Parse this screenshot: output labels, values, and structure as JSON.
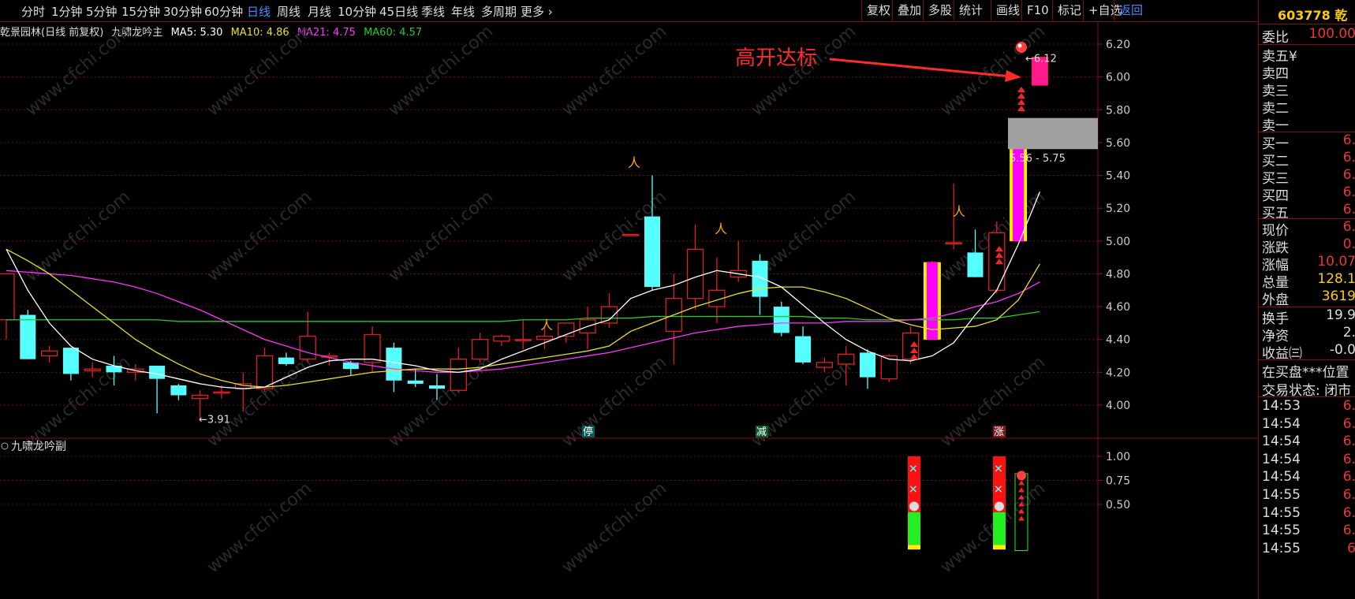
{
  "toolbar": {
    "periods": [
      "分时",
      "1分钟",
      "5分钟",
      "15分钟",
      "30分钟",
      "60分钟",
      "日线",
      "周线",
      "月线",
      "10分钟",
      "45日线",
      "季线",
      "年线",
      "多周期",
      "更多 ›"
    ],
    "active_period": "日线",
    "right_buttons": [
      "复权",
      "叠加",
      "多股",
      "统计",
      "画线",
      "F10",
      "标记",
      "+自选",
      "返回"
    ]
  },
  "legend": {
    "stock_name": "乾景园林(日线 前复权)",
    "indicator": "九啸龙吟主",
    "ma5": "MA5: 5.30",
    "ma10": "MA10: 4.86",
    "ma21": "MA21: 4.75",
    "ma60": "MA60: 4.57"
  },
  "sub_panel": {
    "title": "九啸龙吟副"
  },
  "annotation": {
    "text": "高开达标",
    "price_label": "6.12",
    "low_label": "3.91",
    "range_label": "5.56 - 5.75"
  },
  "markers": {
    "ting": "停",
    "jian": "减",
    "zhang": "涨"
  },
  "watermark": "www.cfchi.com",
  "colors": {
    "up": "#e02020",
    "down": "#55ffff",
    "ma5": "#ffffff",
    "ma10": "#e8e020",
    "ma21": "#ff33ff",
    "ma60": "#22cc22",
    "axis": "#8a1010"
  },
  "right_panel": {
    "code": "603778",
    "name": "乾",
    "weibi_label": "委比",
    "weibi_value": "100.00",
    "sell_labels": [
      "卖五",
      "卖四",
      "卖三",
      "卖二",
      "卖一"
    ],
    "sell_yen": "¥",
    "buy_labels": [
      "买一",
      "买二",
      "买三",
      "买四",
      "买五"
    ],
    "buy_values": [
      "6.",
      "6.",
      "6.",
      "6.",
      "6."
    ],
    "stats": [
      {
        "label": "现价",
        "value": "6."
      },
      {
        "label": "涨跌",
        "value": "0."
      },
      {
        "label": "涨幅",
        "value": "10.07"
      },
      {
        "label": "总量",
        "value": "128.1"
      },
      {
        "label": "外盘",
        "value": "3619"
      }
    ],
    "stats2": [
      {
        "label": "换手",
        "value": "19.9"
      },
      {
        "label": "净资",
        "value": "2."
      },
      {
        "label": "收益㈢",
        "value": "-0.0"
      }
    ],
    "status1": "在买盘***位置",
    "status2": "交易状态: 闭市",
    "ticks": [
      {
        "time": "14:53",
        "price": "6."
      },
      {
        "time": "14:54",
        "price": "6."
      },
      {
        "time": "14:54",
        "price": "6."
      },
      {
        "time": "14:54",
        "price": "6."
      },
      {
        "time": "14:54",
        "price": "6."
      },
      {
        "time": "14:55",
        "price": "6."
      },
      {
        "time": "14:55",
        "price": "6."
      },
      {
        "time": "14:55",
        "price": "6."
      },
      {
        "time": "14:55",
        "price": "6"
      }
    ]
  },
  "chart_data": {
    "type": "candlestick",
    "ylim": [
      3.85,
      6.3
    ],
    "yticks": [
      "6.20",
      "6.00",
      "5.80",
      "5.60",
      "5.40",
      "5.20",
      "5.00",
      "4.80",
      "4.60",
      "4.40",
      "4.20",
      "4.00"
    ],
    "sub_yticks": [
      "1.00",
      "0.75",
      "0.50"
    ],
    "candles": [
      {
        "o": 4.52,
        "h": 4.8,
        "l": 4.4,
        "c": 4.8
      },
      {
        "o": 4.55,
        "h": 4.58,
        "l": 4.28,
        "c": 4.28
      },
      {
        "o": 4.3,
        "h": 4.36,
        "l": 4.26,
        "c": 4.33
      },
      {
        "o": 4.35,
        "h": 4.35,
        "l": 4.15,
        "c": 4.19
      },
      {
        "o": 4.21,
        "h": 4.26,
        "l": 4.17,
        "c": 4.22
      },
      {
        "o": 4.24,
        "h": 4.3,
        "l": 4.12,
        "c": 4.2
      },
      {
        "o": 4.2,
        "h": 4.25,
        "l": 4.15,
        "c": 4.22
      },
      {
        "o": 4.24,
        "h": 4.24,
        "l": 3.95,
        "c": 4.16
      },
      {
        "o": 4.12,
        "h": 4.13,
        "l": 4.03,
        "c": 4.06
      },
      {
        "o": 4.04,
        "h": 4.09,
        "l": 3.91,
        "c": 4.06
      },
      {
        "o": 4.08,
        "h": 4.12,
        "l": 4.04,
        "c": 4.08
      },
      {
        "o": 4.1,
        "h": 4.2,
        "l": 3.96,
        "c": 4.13
      },
      {
        "o": 4.1,
        "h": 4.35,
        "l": 4.08,
        "c": 4.3
      },
      {
        "o": 4.29,
        "h": 4.32,
        "l": 4.24,
        "c": 4.25
      },
      {
        "o": 4.28,
        "h": 4.57,
        "l": 4.26,
        "c": 4.42
      },
      {
        "o": 4.3,
        "h": 4.32,
        "l": 4.24,
        "c": 4.3
      },
      {
        "o": 4.26,
        "h": 4.27,
        "l": 4.18,
        "c": 4.22
      },
      {
        "o": 4.26,
        "h": 4.48,
        "l": 4.2,
        "c": 4.43
      },
      {
        "o": 4.35,
        "h": 4.38,
        "l": 4.08,
        "c": 4.15
      },
      {
        "o": 4.15,
        "h": 4.22,
        "l": 4.11,
        "c": 4.13
      },
      {
        "o": 4.12,
        "h": 4.19,
        "l": 4.03,
        "c": 4.1
      },
      {
        "o": 4.09,
        "h": 4.35,
        "l": 4.08,
        "c": 4.28
      },
      {
        "o": 4.28,
        "h": 4.44,
        "l": 4.26,
        "c": 4.4
      },
      {
        "o": 4.39,
        "h": 4.43,
        "l": 4.36,
        "c": 4.42
      },
      {
        "o": 4.4,
        "h": 4.52,
        "l": 4.34,
        "c": 4.4
      },
      {
        "o": 4.4,
        "h": 4.48,
        "l": 4.34,
        "c": 4.42
      },
      {
        "o": 4.42,
        "h": 4.5,
        "l": 4.38,
        "c": 4.5
      },
      {
        "o": 4.44,
        "h": 4.6,
        "l": 4.34,
        "c": 4.52
      },
      {
        "o": 4.5,
        "h": 4.68,
        "l": 4.47,
        "c": 4.6
      },
      {
        "o": 5.04,
        "h": 5.04,
        "l": 5.04,
        "c": 5.04
      },
      {
        "o": 5.15,
        "h": 5.4,
        "l": 4.7,
        "c": 4.72
      },
      {
        "o": 4.45,
        "h": 4.8,
        "l": 4.25,
        "c": 4.65
      },
      {
        "o": 4.65,
        "h": 5.1,
        "l": 4.58,
        "c": 4.95
      },
      {
        "o": 4.6,
        "h": 4.9,
        "l": 4.5,
        "c": 4.7
      },
      {
        "o": 4.78,
        "h": 5.0,
        "l": 4.75,
        "c": 4.82
      },
      {
        "o": 4.88,
        "h": 4.92,
        "l": 4.55,
        "c": 4.66
      },
      {
        "o": 4.6,
        "h": 4.63,
        "l": 4.42,
        "c": 4.44
      },
      {
        "o": 4.42,
        "h": 4.48,
        "l": 4.25,
        "c": 4.26
      },
      {
        "o": 4.23,
        "h": 4.29,
        "l": 4.2,
        "c": 4.26
      },
      {
        "o": 4.25,
        "h": 4.36,
        "l": 4.12,
        "c": 4.31
      },
      {
        "o": 4.32,
        "h": 4.34,
        "l": 4.1,
        "c": 4.17
      },
      {
        "o": 4.16,
        "h": 4.31,
        "l": 4.14,
        "c": 4.3
      },
      {
        "o": 4.28,
        "h": 4.48,
        "l": 4.25,
        "c": 4.44
      },
      {
        "o": 4.4,
        "h": 4.88,
        "l": 4.4,
        "c": 4.87
      },
      {
        "o": 4.99,
        "h": 5.35,
        "l": 4.95,
        "c": 4.99
      },
      {
        "o": 4.93,
        "h": 5.07,
        "l": 4.78,
        "c": 4.78
      },
      {
        "o": 4.7,
        "h": 5.12,
        "l": 4.68,
        "c": 5.05
      },
      {
        "o": 5.0,
        "h": 5.56,
        "l": 5.0,
        "c": 5.56
      },
      {
        "o": 5.95,
        "h": 6.12,
        "l": 5.95,
        "c": 6.12
      }
    ],
    "ma5": [
      4.95,
      4.7,
      4.5,
      4.36,
      4.28,
      4.24,
      4.21,
      4.19,
      4.16,
      4.13,
      4.11,
      4.1,
      4.11,
      4.17,
      4.23,
      4.27,
      4.28,
      4.28,
      4.26,
      4.24,
      4.21,
      4.2,
      4.22,
      4.28,
      4.33,
      4.38,
      4.43,
      4.48,
      4.52,
      4.65,
      4.7,
      4.73,
      4.78,
      4.82,
      4.8,
      4.78,
      4.72,
      4.61,
      4.5,
      4.4,
      4.33,
      4.28,
      4.27,
      4.3,
      4.38,
      4.55,
      4.7,
      4.98,
      5.3
    ],
    "ma10": [
      4.95,
      4.88,
      4.8,
      4.7,
      4.6,
      4.5,
      4.4,
      4.32,
      4.25,
      4.19,
      4.15,
      4.12,
      4.11,
      4.12,
      4.14,
      4.16,
      4.18,
      4.2,
      4.21,
      4.22,
      4.22,
      4.22,
      4.23,
      4.25,
      4.27,
      4.29,
      4.31,
      4.33,
      4.36,
      4.45,
      4.5,
      4.55,
      4.6,
      4.64,
      4.68,
      4.71,
      4.72,
      4.72,
      4.69,
      4.65,
      4.59,
      4.53,
      4.49,
      4.46,
      4.47,
      4.48,
      4.52,
      4.64,
      4.86
    ],
    "ma21": [
      4.82,
      4.81,
      4.8,
      4.79,
      4.77,
      4.75,
      4.72,
      4.68,
      4.63,
      4.58,
      4.52,
      4.46,
      4.4,
      4.36,
      4.32,
      4.29,
      4.26,
      4.24,
      4.22,
      4.21,
      4.2,
      4.2,
      4.21,
      4.22,
      4.24,
      4.26,
      4.28,
      4.3,
      4.32,
      4.35,
      4.38,
      4.41,
      4.44,
      4.46,
      4.48,
      4.49,
      4.5,
      4.5,
      4.5,
      4.51,
      4.51,
      4.51,
      4.52,
      4.53,
      4.56,
      4.6,
      4.63,
      4.68,
      4.75
    ],
    "ma60": [
      4.52,
      4.52,
      4.52,
      4.52,
      4.52,
      4.52,
      4.52,
      4.52,
      4.51,
      4.51,
      4.51,
      4.51,
      4.51,
      4.51,
      4.51,
      4.51,
      4.51,
      4.51,
      4.51,
      4.51,
      4.51,
      4.51,
      4.51,
      4.51,
      4.52,
      4.52,
      4.52,
      4.53,
      4.53,
      4.53,
      4.54,
      4.54,
      4.54,
      4.54,
      4.54,
      4.54,
      4.54,
      4.54,
      4.53,
      4.53,
      4.52,
      4.52,
      4.52,
      4.52,
      4.52,
      4.53,
      4.53,
      4.55,
      4.57
    ]
  }
}
